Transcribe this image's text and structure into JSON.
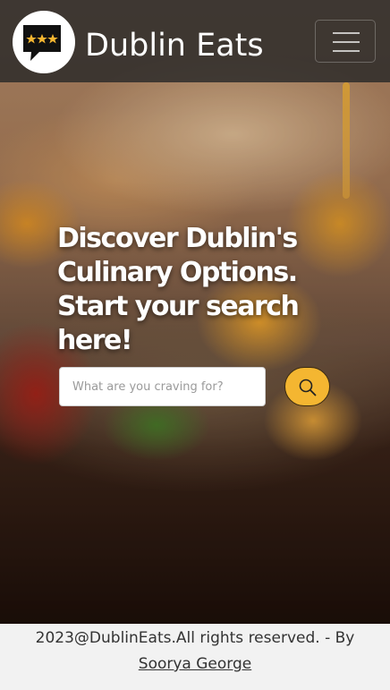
{
  "navbar": {
    "brand_name": "Dublin Eats",
    "logo_icon": "speech-bubble-stars-icon",
    "menu_icon": "hamburger-menu-icon"
  },
  "hero": {
    "headline": "Discover Dublin's Culinary Options. Start your search here!"
  },
  "search": {
    "placeholder": "What are you craving for?",
    "value": "",
    "button_icon": "search-icon"
  },
  "footer": {
    "copyright": "2023@DublinEats.All rights reserved. - By",
    "author_link": "Soorya George"
  },
  "colors": {
    "accent": "#f4b631",
    "navbar_bg": "#282828",
    "footer_bg": "#f2f2f2",
    "text_light": "#ffffff",
    "text_dark": "#333333"
  }
}
